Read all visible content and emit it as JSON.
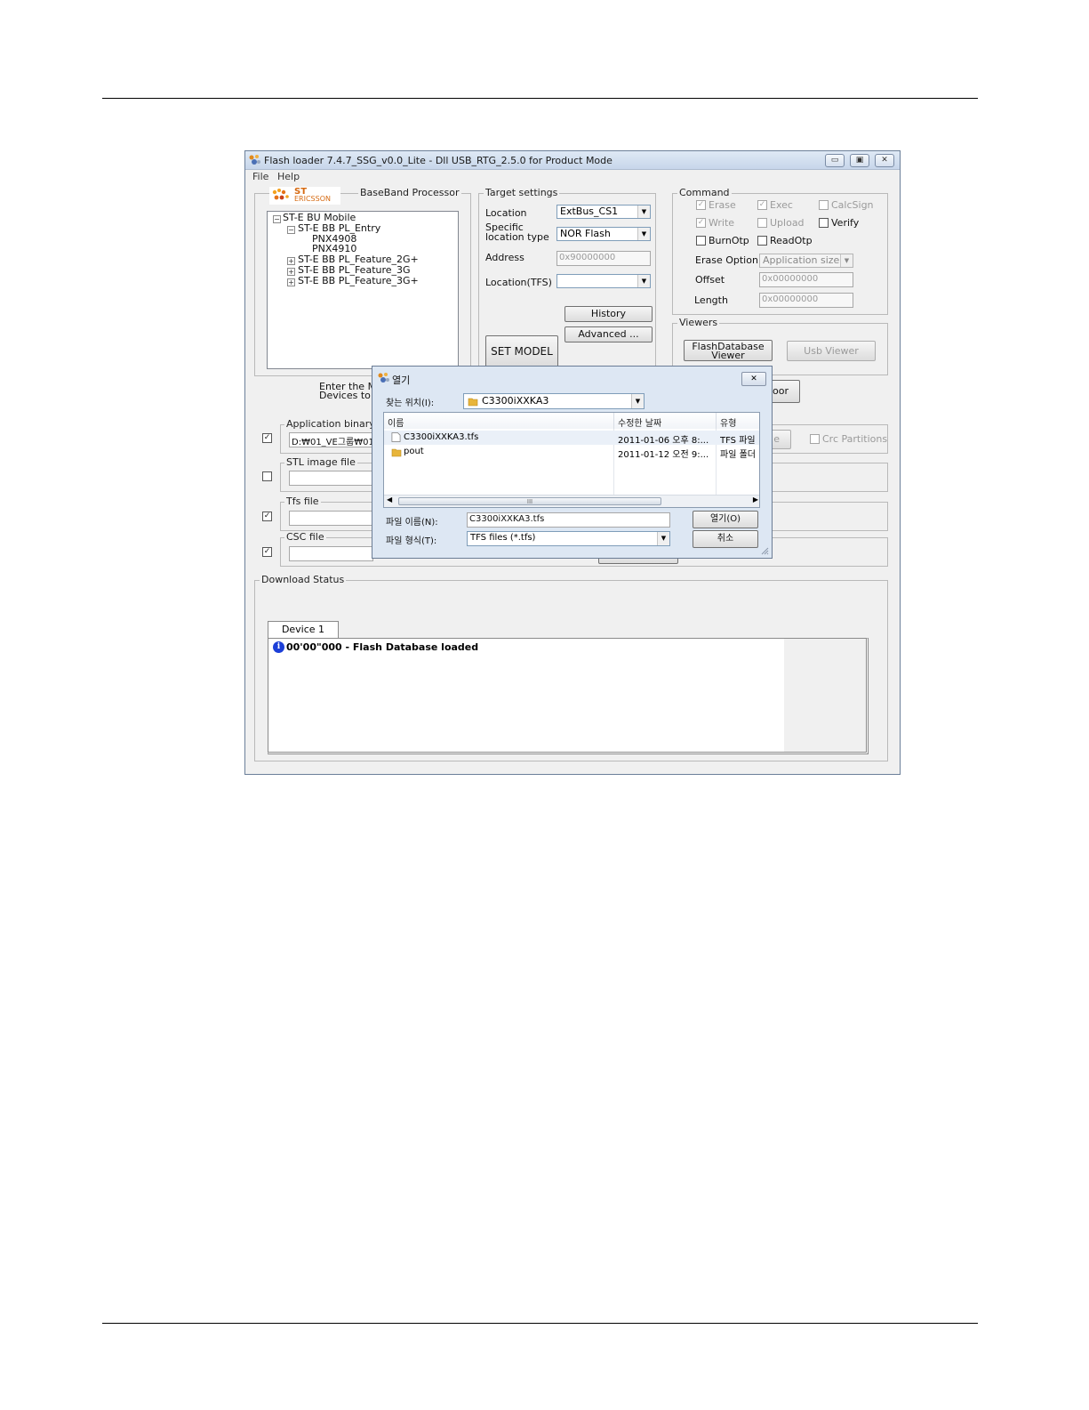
{
  "window": {
    "title": "Flash loader 7.4.7_SSG_v0.0_Lite - Dll USB_RTG_2.5.0  for Product Mode",
    "caption_buttons": {
      "minimize": "▭",
      "maximize": "▣",
      "close": "✕"
    }
  },
  "menu": {
    "file": "File",
    "help": "Help"
  },
  "baseband": {
    "legend": "BaseBand Processor",
    "logo_top": "ST",
    "logo_bottom": "ERICSSON",
    "tree": [
      {
        "expander": "−",
        "label": "ST-E BU Mobile"
      },
      {
        "expander": "−",
        "label": "ST-E BB PL_Entry"
      },
      {
        "expander": "",
        "label": "PNX4908"
      },
      {
        "expander": "",
        "label": "PNX4910"
      },
      {
        "expander": "+",
        "label": "ST-E BB PL_Feature_2G+"
      },
      {
        "expander": "+",
        "label": "ST-E BB PL_Feature_3G"
      },
      {
        "expander": "+",
        "label": "ST-E BB PL_Feature_3G+"
      }
    ]
  },
  "target": {
    "legend": "Target settings",
    "location_label": "Location",
    "location_value": "ExtBus_CS1",
    "specific_label_1": "Specific",
    "specific_label_2": "location type",
    "specific_value": "NOR Flash",
    "address_label": "Address",
    "address_value": "0x90000000",
    "location_tfs_label": "Location(TFS)",
    "location_tfs_value": "",
    "history_button": "History",
    "advanced_button": "Advanced ...",
    "set_model_button": "SET MODEL"
  },
  "command": {
    "legend": "Command",
    "erase": "Erase",
    "exec": "Exec",
    "calcsign": "CalcSign",
    "write": "Write",
    "upload": "Upload",
    "verify": "Verify",
    "burnotp": "BurnOtp",
    "readotp": "ReadOtp",
    "erase_option_label": "Erase Option",
    "erase_option_value": "Application size",
    "offset_label": "Offset",
    "offset_value": "0x00000000",
    "length_label": "Length",
    "length_value": "0x00000000",
    "check_mark": "✓"
  },
  "viewers": {
    "legend": "Viewers",
    "flashdb_line1": "FlashDatabase",
    "flashdb_line2": "Viewer",
    "usb_viewer": "Usb Viewer"
  },
  "middle": {
    "enter_line1": "Enter the Ma",
    "enter_line2": "Devices to F",
    "partial_button": "oor",
    "partial_button2": "e",
    "crc_partitions": "Crc Partitions"
  },
  "files": {
    "application_legend": "Application binary fil",
    "application_value": "D:₩01_VE그룹₩01_",
    "stl_legend": "STL image file",
    "tfs_legend": "Tfs file",
    "csc_legend": "CSC file"
  },
  "download": {
    "legend": "Download Status",
    "tab": "Device 1",
    "info_icon": "i",
    "log_line": "00'00\"000 - Flash Database loaded"
  },
  "dialog": {
    "title": "열기",
    "close": "✕",
    "look_in_label": "찾는 위치(I):",
    "look_in_value": "C3300iXXKA3",
    "columns": {
      "name": "이름",
      "date": "수정한 날짜",
      "type": "유형"
    },
    "rows": [
      {
        "name": "C3300iXXKA3.tfs",
        "date": "2011-01-06 오후 8:...",
        "type": "TFS 파일"
      },
      {
        "name": "pout",
        "date": "2011-01-12 오전 9:...",
        "type": "파일 폴더"
      }
    ],
    "scroll_thumb": "III",
    "filename_label": "파일 이름(N):",
    "filename_value": "C3300iXXKA3.tfs",
    "filetype_label": "파일 형식(T):",
    "filetype_value": "TFS files (*.tfs)",
    "open_button": "열기(O)",
    "cancel_button": "취소"
  }
}
